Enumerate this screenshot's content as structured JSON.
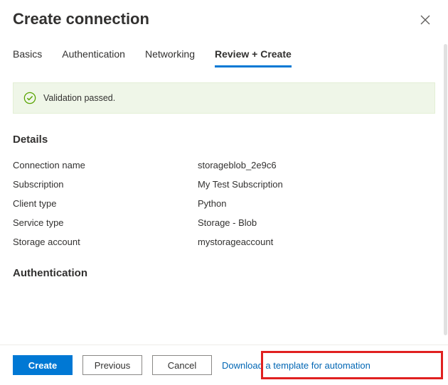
{
  "header": {
    "title": "Create connection"
  },
  "tabs": [
    {
      "label": "Basics",
      "active": false
    },
    {
      "label": "Authentication",
      "active": false
    },
    {
      "label": "Networking",
      "active": false
    },
    {
      "label": "Review + Create",
      "active": true
    }
  ],
  "validation": {
    "message": "Validation passed."
  },
  "sections": {
    "details": {
      "heading": "Details",
      "rows": [
        {
          "k": "Connection name",
          "v": "storageblob_2e9c6"
        },
        {
          "k": "Subscription",
          "v": "My Test Subscription"
        },
        {
          "k": "Client type",
          "v": "Python"
        },
        {
          "k": "Service type",
          "v": "Storage - Blob"
        },
        {
          "k": "Storage account",
          "v": "mystorageaccount"
        }
      ]
    },
    "authentication": {
      "heading": "Authentication"
    }
  },
  "footer": {
    "create": "Create",
    "previous": "Previous",
    "cancel": "Cancel",
    "download": "Download a template for automation"
  }
}
